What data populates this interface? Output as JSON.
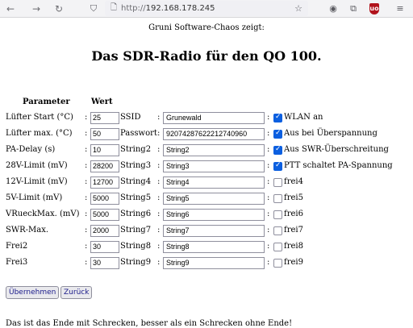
{
  "browser": {
    "url_protocol": "http://",
    "url_host": "192.168.178.245",
    "ublock_badge": "uo"
  },
  "page": {
    "subtitle": "Gruni Software-Chaos zeigt:",
    "title": "Das SDR-Radio für den QO 100.",
    "header_parameter": "Parameter",
    "header_wert": "Wert",
    "colon": ":",
    "rows": [
      {
        "label": "Lüfter Start (°C)",
        "value": "25",
        "slabel": "SSID",
        "svalue": "Grunewald",
        "checked": true,
        "cblabel": "WLAN an"
      },
      {
        "label": "Lüfter max. (°C)",
        "value": "50",
        "slabel": "Passwort",
        "svalue": "92074287622212740960",
        "checked": true,
        "cblabel": "Aus bei Überspannung"
      },
      {
        "label": "PA-Delay (s)",
        "value": "10",
        "slabel": "String2",
        "svalue": "String2",
        "checked": true,
        "cblabel": "Aus SWR-Überschreitung"
      },
      {
        "label": "28V-Limit (mV)",
        "value": "28200",
        "slabel": "String3",
        "svalue": "String3",
        "checked": true,
        "cblabel": "PTT schaltet PA-Spannung"
      },
      {
        "label": "12V-Limit (mV)",
        "value": "12700",
        "slabel": "String4",
        "svalue": "String4",
        "checked": false,
        "cblabel": "frei4"
      },
      {
        "label": "5V-Limit (mV)",
        "value": "5000",
        "slabel": "String5",
        "svalue": "String5",
        "checked": false,
        "cblabel": "frei5"
      },
      {
        "label": "VRueckMax. (mV)",
        "value": "5000",
        "slabel": "String6",
        "svalue": "String6",
        "checked": false,
        "cblabel": "frei6"
      },
      {
        "label": "SWR-Max.",
        "value": "2000",
        "slabel": "String7",
        "svalue": "String7",
        "checked": false,
        "cblabel": "frei7"
      },
      {
        "label": "Frei2",
        "value": "30",
        "slabel": "String8",
        "svalue": "String8",
        "checked": false,
        "cblabel": "frei8"
      },
      {
        "label": "Frei3",
        "value": "30",
        "slabel": "String9",
        "svalue": "String9",
        "checked": false,
        "cblabel": "frei9"
      }
    ],
    "submit_label": "Übernehmen",
    "back_label": "Zurück",
    "footer": "Das ist das Ende mit Schrecken, besser als ein Schrecken ohne Ende!"
  },
  "colors": {
    "checkbox_checked": "#0b5fe0",
    "button_text": "#1a1a8a"
  }
}
